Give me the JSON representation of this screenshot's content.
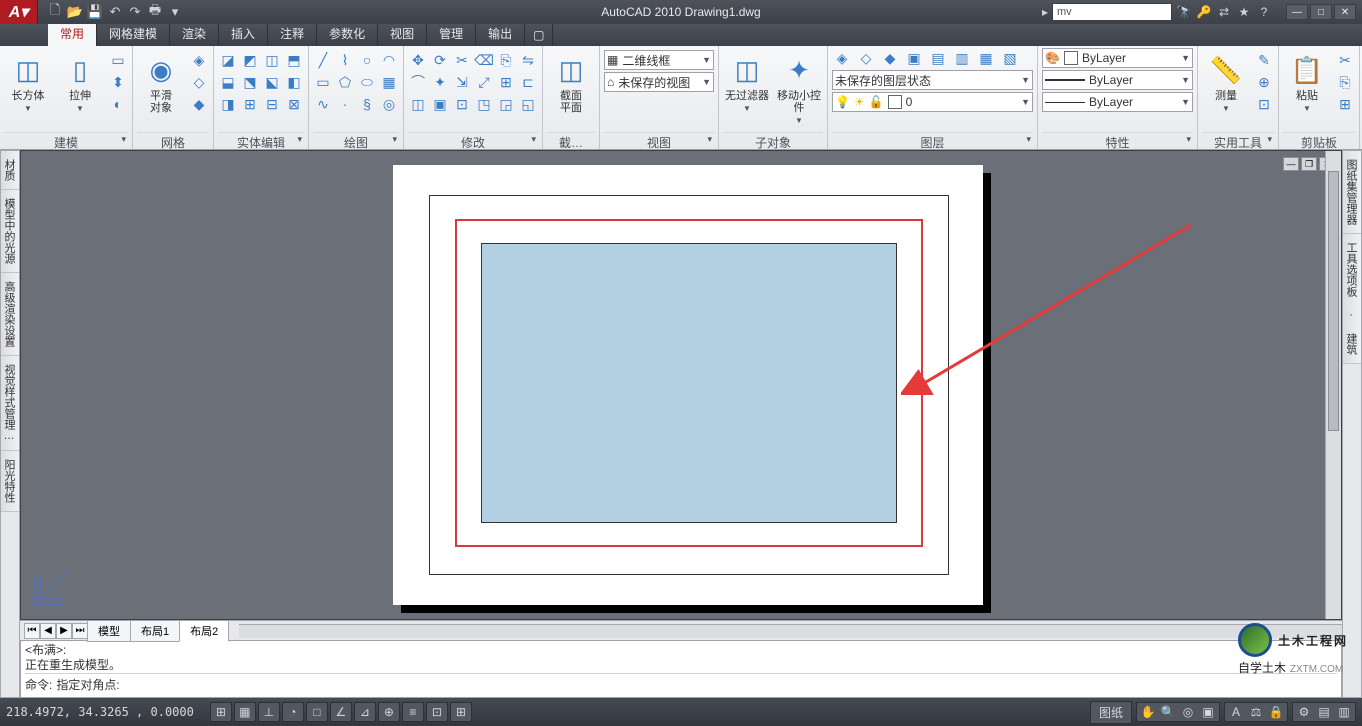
{
  "title": "AutoCAD 2010   Drawing1.dwg",
  "search_value": "mv",
  "menu": {
    "tabs": [
      "常用",
      "网格建模",
      "渲染",
      "插入",
      "注释",
      "参数化",
      "视图",
      "管理",
      "输出"
    ],
    "active": 0
  },
  "panels": {
    "p0": {
      "title": "建模",
      "buttons": [
        {
          "label": "长方体",
          "drop": true
        },
        {
          "label": "拉伸",
          "drop": true
        }
      ]
    },
    "p1": {
      "title": "网格",
      "buttons": [
        {
          "label": "平滑\n对象"
        }
      ]
    },
    "p2": {
      "title": "实体编辑"
    },
    "p3": {
      "title": "绘图"
    },
    "p4": {
      "title": "修改"
    },
    "p5": {
      "title": "截…",
      "buttons": [
        {
          "label": "截面\n平面"
        }
      ]
    },
    "p6": {
      "title": "视图",
      "combo1": "二维线框",
      "combo2": "未保存的视图"
    },
    "p7": {
      "title": "子对象",
      "buttons": [
        {
          "label": "无过滤器"
        },
        {
          "label": "移动小控件"
        }
      ]
    },
    "p8": {
      "title": "图层",
      "combo": "未保存的图层状态",
      "layer": "0"
    },
    "p9": {
      "title": "特性",
      "line1": "ByLayer",
      "line2": "ByLayer",
      "line3": "ByLayer"
    },
    "p10": {
      "title": "实用工具",
      "buttons": [
        {
          "label": "测量"
        }
      ]
    },
    "p11": {
      "title": "剪贴板",
      "buttons": [
        {
          "label": "粘贴"
        }
      ]
    }
  },
  "side_left": [
    "材质",
    "模型中的光源",
    "高级渲染设置",
    "视觉样式管理…",
    "阳光特性"
  ],
  "side_right": [
    "图纸集管理器",
    "工具选项板 · 建筑"
  ],
  "model_tabs": {
    "items": [
      "模型",
      "布局1",
      "布局2"
    ],
    "active": 2
  },
  "command": {
    "l1": "<布满>:",
    "l2": "正在重生成模型。",
    "prompt": "命令:",
    "input": "指定对角点:"
  },
  "status": {
    "coords": "218.4972, 34.3265 , 0.0000",
    "right_label": "图纸"
  },
  "logo": {
    "main": "土木工程网",
    "sub": "自学土木",
    "url": "ZXTM.COM"
  }
}
